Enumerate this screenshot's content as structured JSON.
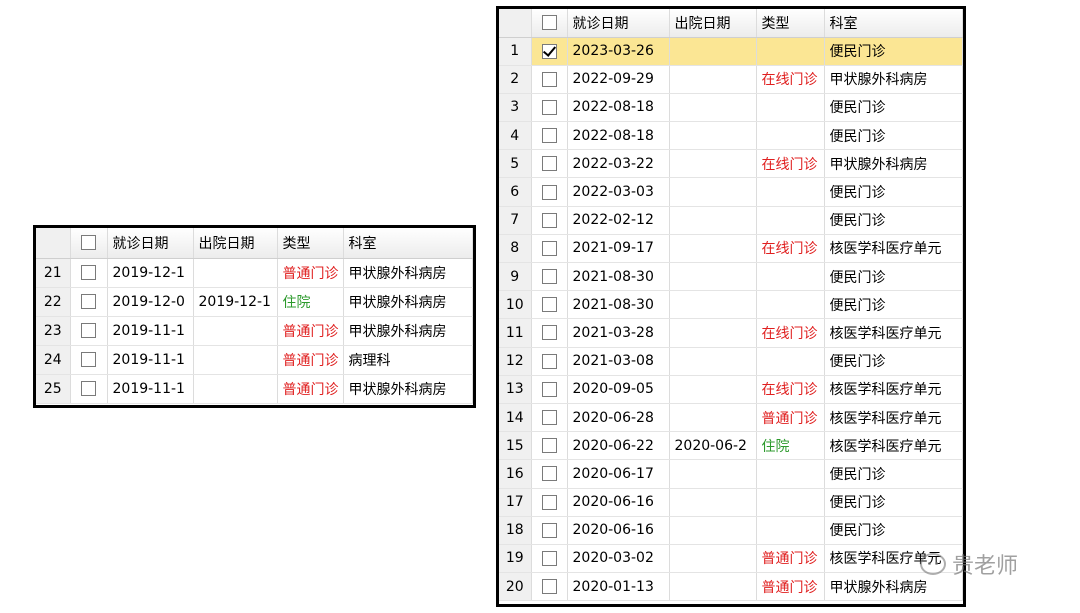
{
  "columns": {
    "date": "就诊日期",
    "discharge": "出院日期",
    "type": "类型",
    "dept": "科室"
  },
  "left_grid": {
    "rows": [
      {
        "num": "21",
        "checked": false,
        "date": "2019-12-1",
        "discharge": "",
        "type": "普通门诊",
        "type_color": "red",
        "dept": "甲状腺外科病房"
      },
      {
        "num": "22",
        "checked": false,
        "date": "2019-12-0",
        "discharge": "2019-12-1",
        "type": "住院",
        "type_color": "green",
        "dept": "甲状腺外科病房"
      },
      {
        "num": "23",
        "checked": false,
        "date": "2019-11-1",
        "discharge": "",
        "type": "普通门诊",
        "type_color": "red",
        "dept": "甲状腺外科病房"
      },
      {
        "num": "24",
        "checked": false,
        "date": "2019-11-1",
        "discharge": "",
        "type": "普通门诊",
        "type_color": "red",
        "dept": "病理科"
      },
      {
        "num": "25",
        "checked": false,
        "date": "2019-11-1",
        "discharge": "",
        "type": "普通门诊",
        "type_color": "red",
        "dept": "甲状腺外科病房"
      }
    ]
  },
  "right_grid": {
    "rows": [
      {
        "num": "1",
        "checked": true,
        "selected": true,
        "date": "2023-03-26",
        "discharge": "",
        "type": "",
        "type_color": "",
        "dept": "便民门诊"
      },
      {
        "num": "2",
        "checked": false,
        "date": "2022-09-29",
        "discharge": "",
        "type": "在线门诊",
        "type_color": "red",
        "dept": "甲状腺外科病房"
      },
      {
        "num": "3",
        "checked": false,
        "date": "2022-08-18",
        "discharge": "",
        "type": "",
        "type_color": "",
        "dept": "便民门诊"
      },
      {
        "num": "4",
        "checked": false,
        "date": "2022-08-18",
        "discharge": "",
        "type": "",
        "type_color": "",
        "dept": "便民门诊"
      },
      {
        "num": "5",
        "checked": false,
        "date": "2022-03-22",
        "discharge": "",
        "type": "在线门诊",
        "type_color": "red",
        "dept": "甲状腺外科病房"
      },
      {
        "num": "6",
        "checked": false,
        "date": "2022-03-03",
        "discharge": "",
        "type": "",
        "type_color": "",
        "dept": "便民门诊"
      },
      {
        "num": "7",
        "checked": false,
        "date": "2022-02-12",
        "discharge": "",
        "type": "",
        "type_color": "",
        "dept": "便民门诊"
      },
      {
        "num": "8",
        "checked": false,
        "date": "2021-09-17",
        "discharge": "",
        "type": "在线门诊",
        "type_color": "red",
        "dept": "核医学科医疗单元"
      },
      {
        "num": "9",
        "checked": false,
        "date": "2021-08-30",
        "discharge": "",
        "type": "",
        "type_color": "",
        "dept": "便民门诊"
      },
      {
        "num": "10",
        "checked": false,
        "date": "2021-08-30",
        "discharge": "",
        "type": "",
        "type_color": "",
        "dept": "便民门诊"
      },
      {
        "num": "11",
        "checked": false,
        "date": "2021-03-28",
        "discharge": "",
        "type": "在线门诊",
        "type_color": "red",
        "dept": "核医学科医疗单元"
      },
      {
        "num": "12",
        "checked": false,
        "date": "2021-03-08",
        "discharge": "",
        "type": "",
        "type_color": "",
        "dept": "便民门诊"
      },
      {
        "num": "13",
        "checked": false,
        "date": "2020-09-05",
        "discharge": "",
        "type": "在线门诊",
        "type_color": "red",
        "dept": "核医学科医疗单元"
      },
      {
        "num": "14",
        "checked": false,
        "date": "2020-06-28",
        "discharge": "",
        "type": "普通门诊",
        "type_color": "red",
        "dept": "核医学科医疗单元"
      },
      {
        "num": "15",
        "checked": false,
        "date": "2020-06-22",
        "discharge": "2020-06-2",
        "type": "住院",
        "type_color": "green",
        "dept": "核医学科医疗单元"
      },
      {
        "num": "16",
        "checked": false,
        "date": "2020-06-17",
        "discharge": "",
        "type": "",
        "type_color": "",
        "dept": "便民门诊"
      },
      {
        "num": "17",
        "checked": false,
        "date": "2020-06-16",
        "discharge": "",
        "type": "",
        "type_color": "",
        "dept": "便民门诊"
      },
      {
        "num": "18",
        "checked": false,
        "date": "2020-06-16",
        "discharge": "",
        "type": "",
        "type_color": "",
        "dept": "便民门诊"
      },
      {
        "num": "19",
        "checked": false,
        "date": "2020-03-02",
        "discharge": "",
        "type": "普通门诊",
        "type_color": "red",
        "dept": "核医学科医疗单元"
      },
      {
        "num": "20",
        "checked": false,
        "date": "2020-01-13",
        "discharge": "",
        "type": "普通门诊",
        "type_color": "red",
        "dept": "甲状腺外科病房"
      }
    ]
  },
  "watermark": {
    "text": "贵老师",
    "icon": "wechat-icon"
  },
  "colors": {
    "selected_row": "#fbe694",
    "type_red": "#e02020",
    "type_green": "#2c9a2c"
  }
}
